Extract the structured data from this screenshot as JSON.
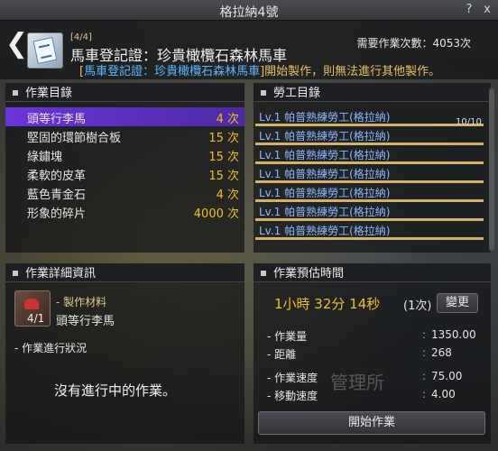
{
  "window": {
    "title": "格拉納4號",
    "help_icon": "?",
    "close_icon": "x"
  },
  "header": {
    "count": "[4/4]",
    "title": "馬車登記證：珍貴橄欖石森林馬車",
    "sub_prefix": "[",
    "sub_highlight": "馬車登記證：珍貴橄欖石森林馬車",
    "sub_suffix": "]開始製作，則無法進行其他製作。",
    "need_label": "需要作業次數：",
    "need_value": "4053次"
  },
  "work_list": {
    "title": "作業目錄",
    "items": [
      {
        "name": "頭等行李馬",
        "count": "4 次"
      },
      {
        "name": "堅固的環節樹合板",
        "count": "15 次"
      },
      {
        "name": "綠鏽塊",
        "count": "15 次"
      },
      {
        "name": "柔軟的皮革",
        "count": "15 次"
      },
      {
        "name": "藍色青金石",
        "count": "4 次"
      },
      {
        "name": "形象的碎片",
        "count": "4000 次"
      }
    ]
  },
  "worker_list": {
    "title": "勞工目錄",
    "counter": "10/10",
    "items": [
      {
        "name": "Lv.1 帕普熟練勞工(格拉納)"
      },
      {
        "name": "Lv.1 帕普熟練勞工(格拉納)"
      },
      {
        "name": "Lv.1 帕普熟練勞工(格拉納)"
      },
      {
        "name": "Lv.1 帕普熟練勞工(格拉納)"
      },
      {
        "name": "Lv.1 帕普熟練勞工(格拉納)"
      },
      {
        "name": "Lv.1 帕普熟練勞工(格拉納)"
      },
      {
        "name": "Lv.1 帕普熟練勞工(格拉納)"
      }
    ]
  },
  "detail": {
    "title": "作業詳細資訊",
    "material_label": "製作材料",
    "material_count": "4/1",
    "material_name": "頭等行李馬",
    "status_label": "作業進行狀況",
    "status_text": "沒有進行中的作業。"
  },
  "estimate": {
    "title": "作業預估時間",
    "time": "1小時 32分 14秒",
    "times": "(1次)",
    "change_button": "變更",
    "rows": [
      {
        "label": "作業量",
        "value": "1350.00"
      },
      {
        "label": "距離",
        "value": "268"
      },
      {
        "label": "作業速度",
        "value": "75.00"
      },
      {
        "label": "移動速度",
        "value": "4.00"
      }
    ],
    "start_button": "開始作業"
  },
  "watermark": "管理所"
}
